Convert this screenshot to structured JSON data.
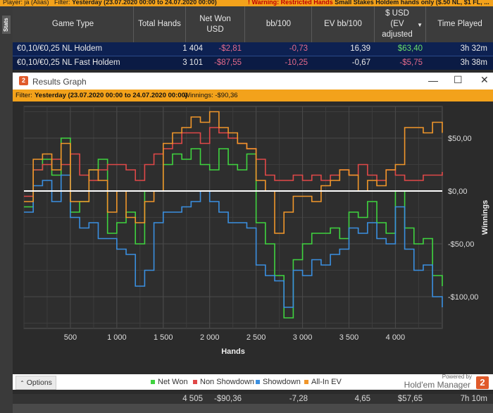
{
  "topbar": {
    "player_label": "Player: ja (Alias)",
    "filter_label": "Filter:",
    "filter_value": "Yesterday (23.07.2020 00:00 to 24.07.2020 00:00)",
    "warning_label": "Warning: Restricted Hands",
    "warning_detail": "Small Stakes Holdem hands only ($.50 NL, $1 FL, ..."
  },
  "sidetab": {
    "label": "Stats"
  },
  "table": {
    "headers": [
      "Game Type",
      "Total Hands",
      "Net Won USD",
      "bb/100",
      "EV bb/100",
      "$ USD (EV adjusted",
      "Time Played"
    ],
    "rows": [
      {
        "game": "€0,10/€0,25 NL Holdem",
        "hands": "1 404",
        "net": "-$2,81",
        "bb100": "-0,73",
        "evbb": "16,39",
        "ev_usd": "$63,40",
        "time": "3h 32m"
      },
      {
        "game": "€0,10/€0,25 NL Fast Holdem",
        "hands": "3 101",
        "net": "-$87,55",
        "bb100": "-10,25",
        "evbb": "-0,67",
        "ev_usd": "-$5,75",
        "time": "3h 38m"
      }
    ],
    "totals": {
      "hands": "4 505",
      "net": "-$90,36",
      "bb100": "-7,28",
      "evbb": "4,65",
      "ev_usd": "$57,65",
      "time": "7h 10m"
    }
  },
  "graph_window": {
    "title": "Results Graph",
    "logo": "2",
    "filter_label": "Filter:",
    "filter_value": "Yesterday (23.07.2020 00:00 to 24.07.2020 00:00)",
    "winnings_label": "Winnings: -$90,36",
    "options_label": "Options",
    "powered_by": "Powered by",
    "brand": "Hold'em Manager",
    "brand_logo": "2",
    "legend": [
      "Net Won",
      "Non Showdown",
      "Showdown",
      "All-In EV"
    ]
  },
  "chart_data": {
    "type": "line",
    "xlabel": "Hands",
    "ylabel": "Winnings",
    "xlim": [
      0,
      4505
    ],
    "ylim": [
      -130,
      80
    ],
    "x_ticks": [
      500,
      1000,
      1500,
      2000,
      2500,
      3000,
      3500,
      4000
    ],
    "x_tick_labels": [
      "500",
      "1 000",
      "1 500",
      "2 000",
      "2 500",
      "3 000",
      "3 500",
      "4 000"
    ],
    "y_ticks": [
      50,
      0,
      -50,
      -100
    ],
    "y_tick_labels": [
      "$50,00",
      "$0,00",
      "-$50,00",
      "-$100,00"
    ],
    "colors": {
      "Net Won": "#3fd33f",
      "Non Showdown": "#e04848",
      "Showdown": "#3a8fe0",
      "All-In EV": "#f0962a",
      "zero": "#ffffff"
    },
    "x": [
      0,
      100,
      200,
      300,
      400,
      500,
      600,
      700,
      800,
      900,
      1000,
      1100,
      1200,
      1300,
      1400,
      1500,
      1600,
      1700,
      1800,
      1900,
      2000,
      2100,
      2200,
      2300,
      2400,
      2500,
      2600,
      2700,
      2800,
      2900,
      3000,
      3100,
      3200,
      3300,
      3400,
      3500,
      3600,
      3700,
      3800,
      3900,
      4000,
      4100,
      4200,
      4300,
      4400,
      4505
    ],
    "series": [
      {
        "name": "Net Won",
        "values": [
          -15,
          20,
          30,
          15,
          50,
          -20,
          -10,
          20,
          30,
          -40,
          -30,
          -20,
          -50,
          0,
          0,
          25,
          35,
          30,
          40,
          25,
          20,
          40,
          25,
          20,
          35,
          -30,
          -50,
          -80,
          -120,
          -65,
          -50,
          -40,
          -40,
          -35,
          -45,
          -20,
          -25,
          -10,
          -30,
          -40,
          0,
          -35,
          -50,
          -45,
          -80,
          -90
        ]
      },
      {
        "name": "Non Showdown",
        "values": [
          -5,
          20,
          25,
          30,
          25,
          35,
          15,
          10,
          20,
          25,
          25,
          20,
          10,
          25,
          35,
          40,
          45,
          55,
          55,
          45,
          60,
          55,
          50,
          45,
          40,
          30,
          15,
          10,
          10,
          15,
          10,
          15,
          10,
          15,
          20,
          15,
          25,
          15,
          10,
          20,
          15,
          10,
          10,
          15,
          15,
          18
        ]
      },
      {
        "name": "Showdown",
        "values": [
          -20,
          5,
          10,
          -10,
          15,
          -25,
          -35,
          -30,
          -45,
          -45,
          -55,
          -60,
          -90,
          -75,
          -30,
          -20,
          -20,
          -15,
          -10,
          0,
          -10,
          -20,
          -30,
          -30,
          -35,
          -70,
          -80,
          -85,
          -110,
          -75,
          -80,
          -65,
          -70,
          -60,
          -55,
          -35,
          -40,
          -30,
          -45,
          -50,
          -15,
          -55,
          -75,
          -70,
          -100,
          -110
        ]
      },
      {
        "name": "All-In EV",
        "values": [
          -10,
          30,
          35,
          20,
          45,
          -10,
          -10,
          20,
          10,
          -20,
          0,
          -25,
          -30,
          -10,
          0,
          45,
          55,
          60,
          70,
          65,
          75,
          60,
          55,
          45,
          40,
          10,
          0,
          -40,
          -20,
          -5,
          -5,
          -10,
          5,
          10,
          20,
          15,
          0,
          10,
          5,
          20,
          25,
          60,
          60,
          55,
          65,
          55
        ]
      }
    ]
  }
}
